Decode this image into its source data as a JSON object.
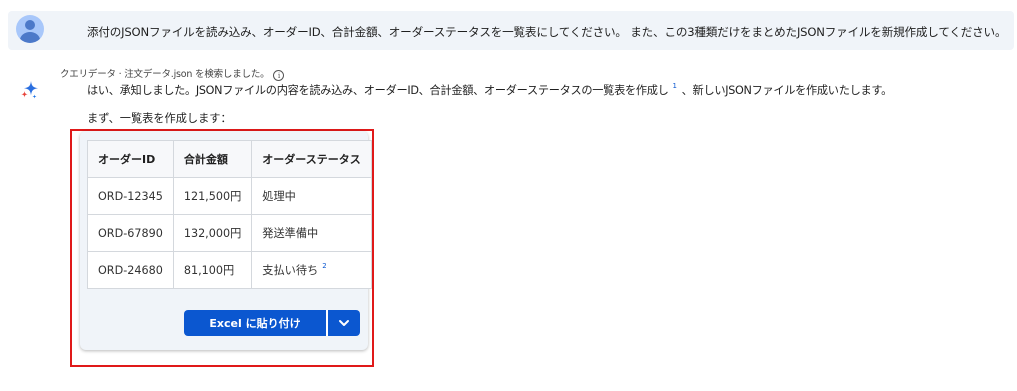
{
  "user": {
    "avatar_icon": "user-avatar-icon",
    "message": "添付のJSONファイルを読み込み、オーダーID、合計金額、オーダーステータスを一覧表にしてください。 また、この3種類だけをまとめたJSONファイルを新規作成してください。"
  },
  "assistant": {
    "icon": "sparkle-icon",
    "source_text": "クエリデータ · 注文データ.json を検索しました。",
    "source_info_icon": "info-icon",
    "answer_part1": "はい、承知しました。JSONファイルの内容を読み込み、オーダーID、合計金額、オーダーステータスの一覧表を作成し",
    "ref1": "1",
    "answer_part2": "、新しいJSONファイルを作成いたします。",
    "intro": "まず、一覧表を作成します："
  },
  "table": {
    "headers": [
      "オーダーID",
      "合計金額",
      "オーダーステータス"
    ],
    "rows": [
      [
        "ORD-12345",
        "121,500円",
        "処理中"
      ],
      [
        "ORD-67890",
        "132,000円",
        "発送準備中"
      ],
      [
        "ORD-24680",
        "81,100円",
        "支払い待ち"
      ]
    ],
    "row3_ref": "2"
  },
  "actions": {
    "paste_excel_label": "Excel に貼り付け",
    "dropdown_icon": "chevron-down-icon"
  },
  "colors": {
    "accent": "#0b57d0",
    "highlight_border": "#e01919",
    "user_bubble": "#f0f4f9"
  }
}
